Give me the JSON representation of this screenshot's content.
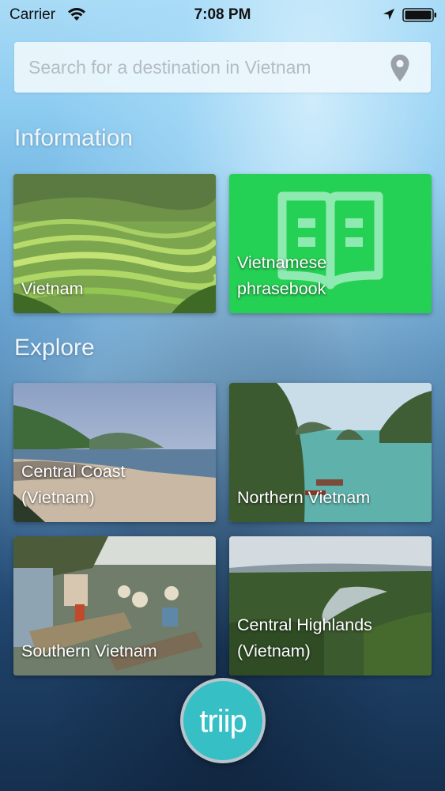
{
  "status_bar": {
    "carrier": "Carrier",
    "time": "7:08 PM",
    "icons": [
      "wifi-icon",
      "location-arrow-icon",
      "battery-icon"
    ]
  },
  "search": {
    "placeholder": "Search for a destination in Vietnam",
    "value": "",
    "icon": "map-pin-icon"
  },
  "sections": {
    "information": {
      "title": "Information",
      "cards": [
        {
          "label": "Vietnam"
        },
        {
          "label": "Vietnamese\nphrasebook",
          "icon": "book-icon",
          "color": "#25d154"
        }
      ]
    },
    "explore": {
      "title": "Explore",
      "cards": [
        {
          "label": "Central Coast\n(Vietnam)"
        },
        {
          "label": "Northern Vietnam"
        },
        {
          "label": "Southern Vietnam"
        },
        {
          "label": "Central Highlands\n(Vietnam)"
        }
      ]
    }
  },
  "logo": {
    "text": "triip",
    "color": "#37bfc6"
  }
}
